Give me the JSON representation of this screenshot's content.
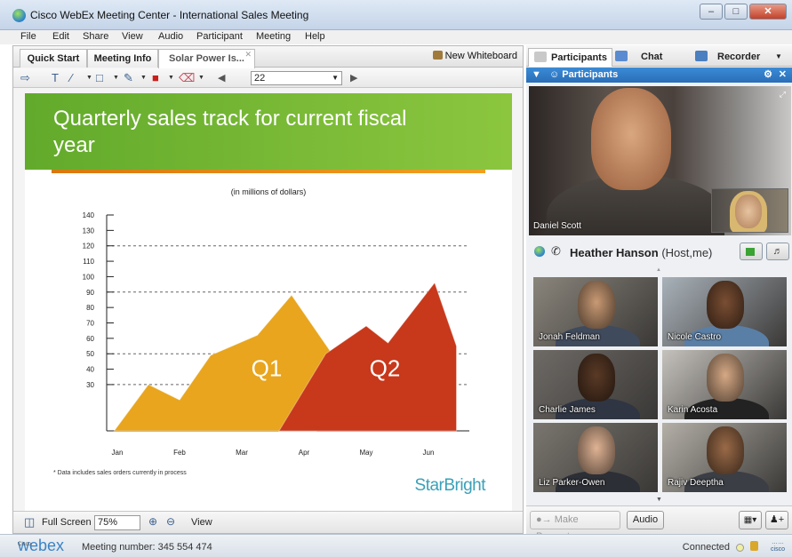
{
  "window": {
    "title": "Cisco WebEx Meeting Center - International Sales Meeting"
  },
  "menu": [
    "File",
    "Edit",
    "Share",
    "View",
    "Audio",
    "Participant",
    "Meeting",
    "Help"
  ],
  "left_tabs": [
    {
      "label": "Quick Start"
    },
    {
      "label": "Meeting Info"
    },
    {
      "label": "Solar Power Is..."
    }
  ],
  "new_whiteboard_label": "New Whiteboard",
  "toolbar": {
    "font_size": "22"
  },
  "slide": {
    "title": "Quarterly sales track for current fiscal year",
    "footnote": "* Data includes sales orders currently in process",
    "brand": "StarBright"
  },
  "chart_data": {
    "type": "area",
    "subtitle": "(in millions of dollars)",
    "categories": [
      "Jan",
      "Feb",
      "Mar",
      "Apr",
      "May",
      "Jun"
    ],
    "yticks": [
      30,
      40,
      50,
      60,
      70,
      80,
      90,
      100,
      110,
      120,
      130,
      140
    ],
    "ylim": [
      0,
      140
    ],
    "reference_lines": [
      30,
      50,
      90,
      120
    ],
    "series": [
      {
        "name": "Q1",
        "color": "#e8a51d",
        "points": [
          [
            -0.05,
            0
          ],
          [
            0.5,
            30
          ],
          [
            1.0,
            20
          ],
          [
            1.5,
            49
          ],
          [
            2.25,
            62
          ],
          [
            2.8,
            88
          ],
          [
            3.45,
            50
          ],
          [
            3.2,
            0
          ]
        ]
      },
      {
        "name": "Q2",
        "color": "#c8381b",
        "points": [
          [
            2.6,
            0
          ],
          [
            3.35,
            50
          ],
          [
            4.0,
            68
          ],
          [
            4.35,
            57
          ],
          [
            5.1,
            96
          ],
          [
            5.45,
            55
          ],
          [
            5.45,
            0
          ]
        ]
      }
    ]
  },
  "bottom": {
    "full_screen_label": "Full Screen",
    "zoom": "75%",
    "view_label": "View"
  },
  "status": {
    "logo": "webex",
    "logo_small": "Cisco",
    "meeting_number": "Meeting number: 345 554 474",
    "connection": "Connected",
    "cisco": "cisco"
  },
  "right_tabs": [
    {
      "label": "Participants",
      "icon": "participants-icon"
    },
    {
      "label": "Chat",
      "icon": "chat-icon"
    },
    {
      "label": "Recorder",
      "icon": "recorder-icon"
    }
  ],
  "participants_panel": {
    "title": "Participants"
  },
  "active_speaker": {
    "name": "Daniel Scott"
  },
  "host": {
    "name": "Heather Hanson",
    "role": "(Host,me)"
  },
  "participants": [
    {
      "name": "Jonah Feldman",
      "skin": "#c99a74",
      "shirt": "#3f4a5c",
      "bg": "#8a857c"
    },
    {
      "name": "Nicole Castro",
      "skin": "#7a4e33",
      "shirt": "#5a7fa6",
      "bg": "#a9b2ba"
    },
    {
      "name": "Charlie James",
      "skin": "#5a3a26",
      "shirt": "#2f3542",
      "bg": "#6e6a66"
    },
    {
      "name": "Karin Acosta",
      "skin": "#d6a985",
      "shirt": "#222222",
      "bg": "#c5c2bd"
    },
    {
      "name": "Liz Parker-Owen",
      "skin": "#e0b394",
      "shirt": "#2d2f36",
      "bg": "#7a766f"
    },
    {
      "name": "Rajiv Deeptha",
      "skin": "#9a6a48",
      "shirt": "#3b3e45",
      "bg": "#b4b0a8"
    }
  ],
  "actions": {
    "make_presenter": "Make Presenter",
    "audio": "Audio"
  }
}
